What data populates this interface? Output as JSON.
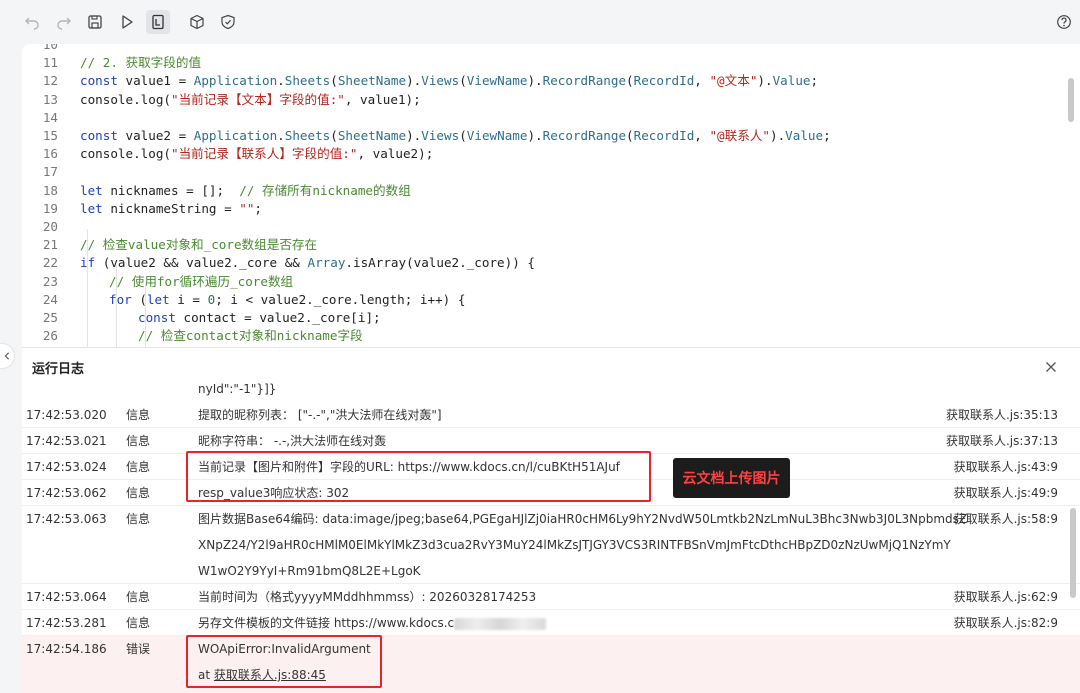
{
  "toolbar": {
    "icons": [
      "undo-icon",
      "redo-icon",
      "save-icon",
      "run-icon",
      "log-icon",
      "cube-icon",
      "shield-icon",
      "help-icon"
    ]
  },
  "editor": {
    "lines": [
      {
        "n": "10",
        "indent": 0,
        "tokens": []
      },
      {
        "n": "11",
        "indent": 0,
        "tokens": [
          [
            "cm",
            "// 2. 获取字段的值"
          ]
        ]
      },
      {
        "n": "12",
        "indent": 0,
        "tokens": [
          [
            "kw",
            "const"
          ],
          [
            "",
            " value1 = "
          ],
          [
            "fn",
            "Application"
          ],
          [
            "",
            "."
          ],
          [
            "fn",
            "Sheets"
          ],
          [
            "",
            "("
          ],
          [
            "fn",
            "SheetName"
          ],
          [
            "",
            ")."
          ],
          [
            "fn",
            "Views"
          ],
          [
            "",
            "("
          ],
          [
            "fn",
            "ViewName"
          ],
          [
            "",
            ")."
          ],
          [
            "fn",
            "RecordRange"
          ],
          [
            "",
            "("
          ],
          [
            "fn",
            "RecordId"
          ],
          [
            "",
            ", "
          ],
          [
            "str",
            "\"@文本\""
          ],
          [
            "",
            ")."
          ],
          [
            "fn",
            "Value"
          ],
          [
            "",
            ";"
          ]
        ]
      },
      {
        "n": "13",
        "indent": 0,
        "tokens": [
          [
            "",
            "console.log("
          ],
          [
            "str",
            "\"当前记录【文本】字段的值:\""
          ],
          [
            "",
            ", value1);"
          ]
        ]
      },
      {
        "n": "14",
        "indent": 0,
        "tokens": []
      },
      {
        "n": "15",
        "indent": 0,
        "tokens": [
          [
            "kw",
            "const"
          ],
          [
            "",
            " value2 = "
          ],
          [
            "fn",
            "Application"
          ],
          [
            "",
            "."
          ],
          [
            "fn",
            "Sheets"
          ],
          [
            "",
            "("
          ],
          [
            "fn",
            "SheetName"
          ],
          [
            "",
            ")."
          ],
          [
            "fn",
            "Views"
          ],
          [
            "",
            "("
          ],
          [
            "fn",
            "ViewName"
          ],
          [
            "",
            ")."
          ],
          [
            "fn",
            "RecordRange"
          ],
          [
            "",
            "("
          ],
          [
            "fn",
            "RecordId"
          ],
          [
            "",
            ", "
          ],
          [
            "str",
            "\"@联系人\""
          ],
          [
            "",
            ")."
          ],
          [
            "fn",
            "Value"
          ],
          [
            "",
            ";"
          ]
        ]
      },
      {
        "n": "16",
        "indent": 0,
        "tokens": [
          [
            "",
            "console.log("
          ],
          [
            "str",
            "\"当前记录【联系人】字段的值:\""
          ],
          [
            "",
            ", value2);"
          ]
        ]
      },
      {
        "n": "17",
        "indent": 0,
        "tokens": []
      },
      {
        "n": "18",
        "indent": 0,
        "tokens": [
          [
            "kw",
            "let"
          ],
          [
            "",
            " nicknames = [];  "
          ],
          [
            "cm",
            "// 存储所有nickname的数组"
          ]
        ]
      },
      {
        "n": "19",
        "indent": 0,
        "tokens": [
          [
            "kw",
            "let"
          ],
          [
            "",
            " nicknameString = "
          ],
          [
            "str",
            "\"\""
          ],
          [
            "",
            ";"
          ]
        ]
      },
      {
        "n": "20",
        "indent": 0,
        "tokens": []
      },
      {
        "n": "21",
        "indent": 0,
        "tokens": [
          [
            "cm",
            "// 检查value对象和_core数组是否存在"
          ]
        ]
      },
      {
        "n": "22",
        "indent": 0,
        "tokens": [
          [
            "kw",
            "if"
          ],
          [
            "",
            " (value2 && value2._core && "
          ],
          [
            "fn",
            "Array"
          ],
          [
            "",
            ".isArray(value2._core)) {"
          ]
        ]
      },
      {
        "n": "23",
        "indent": 1,
        "tokens": [
          [
            "cm",
            "// 使用for循环遍历_core数组"
          ]
        ]
      },
      {
        "n": "24",
        "indent": 1,
        "tokens": [
          [
            "kw",
            "for"
          ],
          [
            "",
            " ("
          ],
          [
            "kw",
            "let"
          ],
          [
            "",
            " i = "
          ],
          [
            "num",
            "0"
          ],
          [
            "",
            "; i < value2._core.length; i++) {"
          ]
        ]
      },
      {
        "n": "25",
        "indent": 2,
        "tokens": [
          [
            "kw",
            "const"
          ],
          [
            "",
            " contact = value2._core[i];"
          ]
        ]
      },
      {
        "n": "26",
        "indent": 2,
        "tokens": [
          [
            "cm",
            "// 检查contact对象和nickname字段"
          ]
        ]
      }
    ]
  },
  "log": {
    "title": "运行日志",
    "partial_line": "nyId\":\"-1\"}]}",
    "rows": [
      {
        "time": "17:42:53.020",
        "level": "信息",
        "msg": [
          "提取的昵称列表： [\"-.-\",\"洪大法师在线对轰\"]"
        ],
        "src": "获取联系人.js:35:13"
      },
      {
        "time": "17:42:53.021",
        "level": "信息",
        "msg": [
          "昵称字符串： -.-,洪大法师在线对轰"
        ],
        "src": "获取联系人.js:37:13"
      },
      {
        "time": "17:42:53.024",
        "level": "信息",
        "msg": [
          "当前记录【图片和附件】字段的URL: https://www.kdocs.cn/l/cuBKtH51AJuf"
        ],
        "src": "获取联系人.js:43:9"
      },
      {
        "time": "17:42:53.062",
        "level": "信息",
        "msg": [
          "resp_value3响应状态: 302"
        ],
        "src": "获取联系人.js:49:9"
      },
      {
        "time": "17:42:53.063",
        "level": "信息",
        "msg": [
          "图片数据Base64编码: data:image/jpeg;base64,PGEgaHJlZj0iaHR0cHM6Ly9hY2NvdW50Lmtkb2NzLmNuL3Bhc3Nwb3J0L3NpbmdsZ",
          "XNpZ24/Y2l9aHR0cHMlM0ElMkYlMkZ3d3cua2RvY3MuY24lMkZsJTJGY3VCS3RINTFBSnVmJmFtcDthcHBpZD0zNzUwMjQ1NzYmY",
          "W1wO2Y9YyI+Rm91bmQ8L2E+LgoK"
        ],
        "src": "获取联系人.js:58:9"
      },
      {
        "time": "17:42:53.064",
        "level": "信息",
        "msg": [
          "当前时间为（格式yyyyMMddhhmmss）: 20260328174253"
        ],
        "src": "获取联系人.js:62:9"
      },
      {
        "time": "17:42:53.281",
        "level": "信息",
        "msg": [
          "另存文件模板的文件链接 https://www.kdocs.c"
        ],
        "src": "获取联系人.js:82:9"
      },
      {
        "time": "17:42:54.186",
        "level": "错误",
        "msg": [
          "WOApiError:InvalidArgument"
        ],
        "at_prefix": "at ",
        "at_link": "获取联系人.js:88:45",
        "src": ""
      }
    ]
  },
  "annotation": {
    "label": "云文档上传图片",
    "box_color": "#e5252a"
  }
}
